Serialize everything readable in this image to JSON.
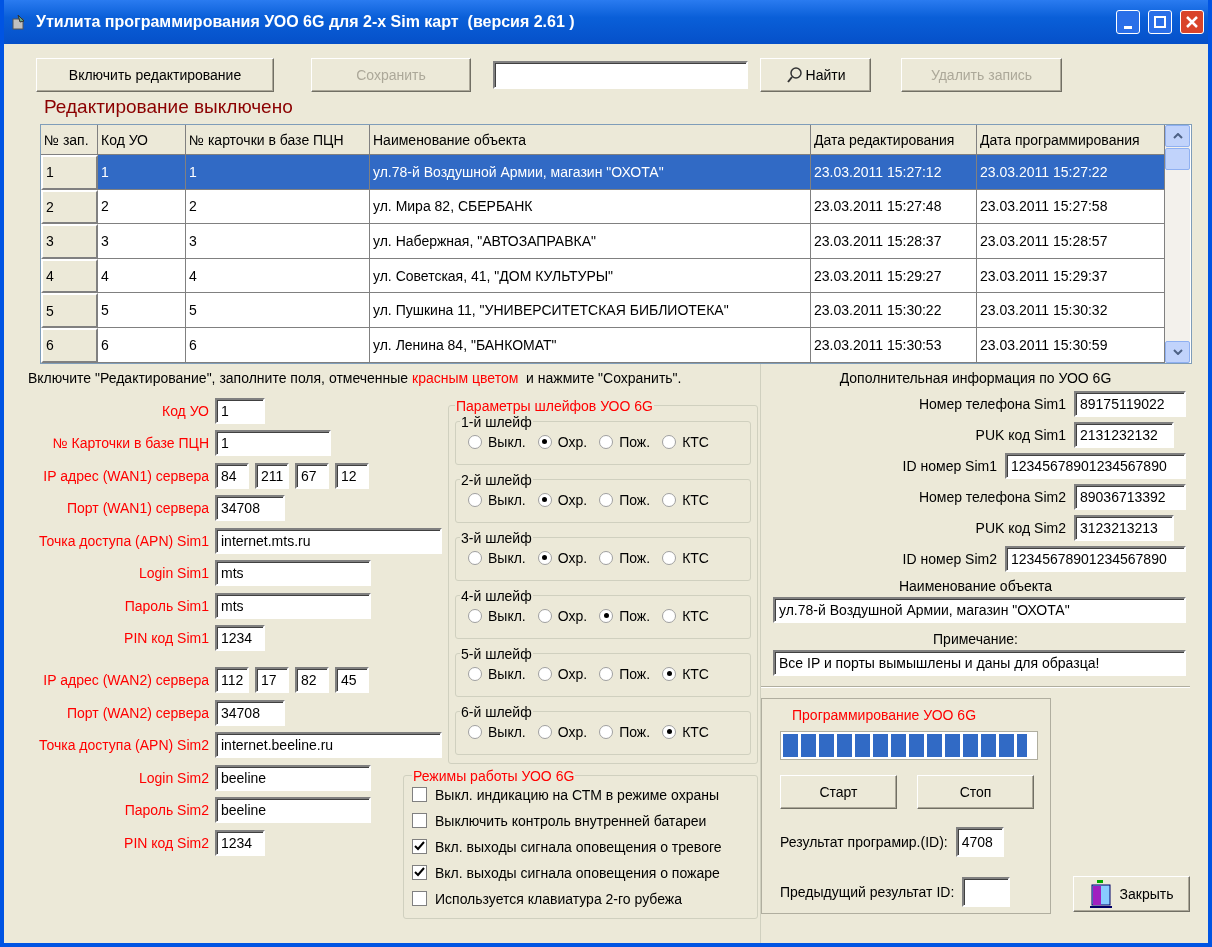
{
  "window": {
    "title": "Утилита программирования УОО 6G для 2-х Sim карт  (версия 2.61 )"
  },
  "toolbar": [
    {
      "kind": "button",
      "label": "Включить редактирование",
      "disabled": false
    },
    {
      "kind": "button",
      "label": "Сохранить",
      "disabled": true
    },
    {
      "kind": "search"
    },
    {
      "kind": "find",
      "label": "Найти",
      "disabled": false
    },
    {
      "kind": "button",
      "label": "Удалить запись",
      "disabled": true
    }
  ],
  "edit_status": "Редактирование выключено",
  "table": {
    "columns": [
      "№ зап.",
      "Код УО",
      "№ карточки в базе ПЦН",
      "Наименование объекта",
      "Дата редактирования",
      "Дата программирования"
    ],
    "rows": [
      {
        "selected": true,
        "cells": [
          "1",
          "1",
          "1",
          "ул.78-й Воздушной Армии, магазин \"ОХОТА\"",
          "23.03.2011 15:27:12",
          "23.03.2011 15:27:22"
        ]
      },
      {
        "selected": false,
        "cells": [
          "2",
          "2",
          "2",
          "ул. Мира 82, СБЕРБАНК",
          "23.03.2011 15:27:48",
          "23.03.2011 15:27:58"
        ]
      },
      {
        "selected": false,
        "cells": [
          "3",
          "3",
          "3",
          "ул. Набержная, \"АВТОЗАПРАВКА\"",
          "23.03.2011 15:28:37",
          "23.03.2011 15:28:57"
        ]
      },
      {
        "selected": false,
        "cells": [
          "4",
          "4",
          "4",
          "ул. Советская, 41, \"ДОМ КУЛЬТУРЫ\"",
          "23.03.2011 15:29:27",
          "23.03.2011 15:29:37"
        ]
      },
      {
        "selected": false,
        "cells": [
          "5",
          "5",
          "5",
          "ул. Пушкина 11, \"УНИВЕРСИТЕТСКАЯ БИБЛИОТЕКА\"",
          "23.03.2011 15:30:22",
          "23.03.2011 15:30:32"
        ]
      },
      {
        "selected": false,
        "cells": [
          "6",
          "6",
          "6",
          "ул. Ленина 84, \"БАНКОМАТ\"",
          "23.03.2011 15:30:53",
          "23.03.2011 15:30:59"
        ]
      }
    ]
  },
  "instruction": [
    {
      "text": "Включите \"Редактирование\", заполните поля, отмеченные ",
      "highlight": false
    },
    {
      "text": "красным цветом",
      "highlight": true
    },
    {
      "text": "  и нажмите \"Сохранить\".",
      "highlight": false
    }
  ],
  "field_groups": [
    {
      "fields": [
        {
          "label": "Код УО",
          "kind": "small",
          "required": true,
          "value": "1"
        },
        {
          "label": "№ Карточки в базе ПЦН",
          "kind": "medium",
          "required": true,
          "value": "1"
        },
        {
          "label": "IP адрес (WAN1) сервера",
          "kind": "ip",
          "required": true,
          "values": [
            "84",
            "211",
            "67",
            "12"
          ]
        },
        {
          "label": "Порт (WAN1) сервера",
          "kind": "port",
          "required": true,
          "value": "34708"
        },
        {
          "label": "Точка доступа (APN) Sim1",
          "kind": "large",
          "required": true,
          "value": "internet.mts.ru"
        },
        {
          "label": "Login Sim1",
          "kind": "wide",
          "required": true,
          "value": "mts"
        },
        {
          "label": "Пароль Sim1",
          "kind": "wide",
          "required": true,
          "value": "mts"
        },
        {
          "label": "PIN код Sim1",
          "kind": "small",
          "required": true,
          "value": "1234"
        }
      ]
    },
    {
      "fields": [
        {
          "label": "IP адрес (WAN2) сервера",
          "kind": "ip",
          "required": true,
          "values": [
            "112",
            "17",
            "82",
            "45"
          ]
        },
        {
          "label": "Порт (WAN2) сервера",
          "kind": "port",
          "required": true,
          "value": "34708"
        },
        {
          "label": "Точка доступа (APN) Sim2",
          "kind": "large",
          "required": true,
          "value": "internet.beeline.ru"
        },
        {
          "label": "Login Sim2",
          "kind": "wide",
          "required": true,
          "value": "beeline"
        },
        {
          "label": "Пароль Sim2",
          "kind": "wide",
          "required": true,
          "value": "beeline"
        },
        {
          "label": "PIN код Sim2",
          "kind": "small",
          "required": true,
          "value": "1234"
        }
      ]
    }
  ],
  "loops": {
    "title": "Параметры шлейфов УОО 6G",
    "items": [
      {
        "title": "1-й шлейф",
        "options": [
          {
            "label": "Выкл.",
            "selected": false
          },
          {
            "label": "Охр.",
            "selected": true
          },
          {
            "label": "Пож.",
            "selected": false
          },
          {
            "label": "КТС",
            "selected": false
          }
        ]
      },
      {
        "title": "2-й шлейф",
        "options": [
          {
            "label": "Выкл.",
            "selected": false
          },
          {
            "label": "Охр.",
            "selected": true
          },
          {
            "label": "Пож.",
            "selected": false
          },
          {
            "label": "КТС",
            "selected": false
          }
        ]
      },
      {
        "title": "3-й шлейф",
        "options": [
          {
            "label": "Выкл.",
            "selected": false
          },
          {
            "label": "Охр.",
            "selected": true
          },
          {
            "label": "Пож.",
            "selected": false
          },
          {
            "label": "КТС",
            "selected": false
          }
        ]
      },
      {
        "title": "4-й шлейф",
        "options": [
          {
            "label": "Выкл.",
            "selected": false
          },
          {
            "label": "Охр.",
            "selected": false
          },
          {
            "label": "Пож.",
            "selected": true
          },
          {
            "label": "КТС",
            "selected": false
          }
        ]
      },
      {
        "title": "5-й шлейф",
        "options": [
          {
            "label": "Выкл.",
            "selected": false
          },
          {
            "label": "Охр.",
            "selected": false
          },
          {
            "label": "Пож.",
            "selected": false
          },
          {
            "label": "КТС",
            "selected": true
          }
        ]
      },
      {
        "title": "6-й шлейф",
        "options": [
          {
            "label": "Выкл.",
            "selected": false
          },
          {
            "label": "Охр.",
            "selected": false
          },
          {
            "label": "Пож.",
            "selected": false
          },
          {
            "label": "КТС",
            "selected": true
          }
        ]
      }
    ]
  },
  "modes": {
    "title": "Режимы работы УОО 6G",
    "items": [
      {
        "label": "Выкл. индикацию на СТМ в режиме охраны",
        "checked": false
      },
      {
        "label": "Выключить контроль внутренней батареи",
        "checked": false
      },
      {
        "label": "Вкл. выходы сигнала оповещения о тревоге",
        "checked": true
      },
      {
        "label": "Вкл. выходы сигнала оповещения о пожаре",
        "checked": true
      },
      {
        "label": "Используется клавиатура 2-го рубежа",
        "checked": false
      }
    ]
  },
  "info": {
    "title": "Дополнительная информация по УОО 6G",
    "fields": [
      {
        "label": "Номер телефона Sim1",
        "kind": "medium",
        "value": "89175119022"
      },
      {
        "label": "PUK код Sim1",
        "kind": "short",
        "value": "2131232132"
      },
      {
        "label": "ID номер Sim1",
        "kind": "long",
        "value": "12345678901234567890"
      },
      {
        "label": "Номер телефона Sim2",
        "kind": "medium",
        "value": "89036713392"
      },
      {
        "label": "PUK код Sim2",
        "kind": "short",
        "value": "3123213213"
      },
      {
        "label": "ID номер Sim2",
        "kind": "long",
        "value": "12345678901234567890"
      }
    ],
    "object_label": "Наименование объекта",
    "object_value": "ул.78-й Воздушной Армии, магазин \"ОХОТА\"",
    "note_label": "Примечание:",
    "note_value": "Все IP и порты вымышлены и даны для образца!"
  },
  "programming": {
    "title": "Программирование УОО 6G",
    "level": 0.97,
    "buttons": [
      "Старт",
      "Стоп"
    ],
    "result_label": "Результат програмир.(ID):",
    "result_value": "4708",
    "previous_label": "Предыдущий результат ID:"
  },
  "close_button": {
    "label": "Закрыть"
  }
}
